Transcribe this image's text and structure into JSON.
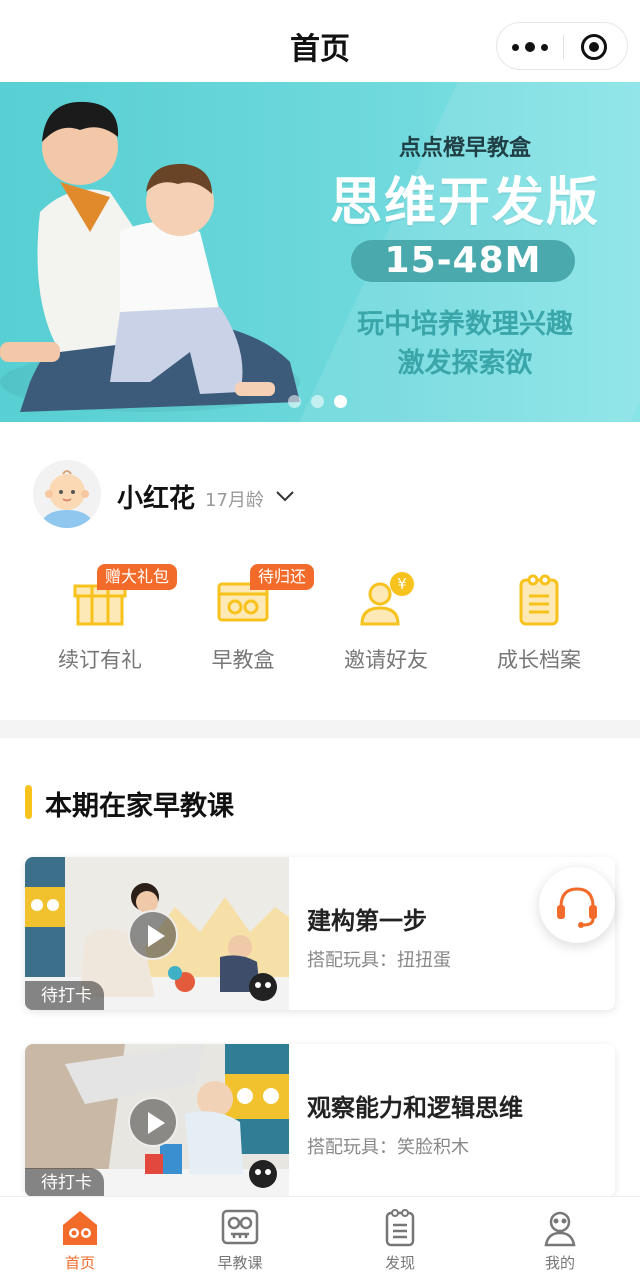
{
  "titlebar": {
    "title": "首页"
  },
  "banner": {
    "brand": "点点橙早教盒",
    "headline": "思维开发版",
    "age_range": "15-48M",
    "line1": "玩中培养数理兴趣",
    "line2": "激发探索欲",
    "slides_total": 3,
    "active_slide": 3
  },
  "profile": {
    "name": "小红花",
    "age": "17月龄"
  },
  "quick_actions": [
    {
      "label": "续订有礼",
      "tag": "赠大礼包",
      "icon": "gift-box-icon"
    },
    {
      "label": "早教盒",
      "tag": "待归还",
      "icon": "box-icon"
    },
    {
      "label": "邀请好友",
      "tag": "",
      "icon": "invite-friend-icon"
    },
    {
      "label": "成长档案",
      "tag": "",
      "icon": "growth-record-icon"
    }
  ],
  "section": {
    "title": "本期在家早教课"
  },
  "courses": [
    {
      "title": "建构第一步",
      "subtitle": "搭配玩具：扭扭蛋",
      "status": "待打卡"
    },
    {
      "title": "观察能力和逻辑思维",
      "subtitle": "搭配玩具：笑脸积木",
      "status": "待打卡"
    }
  ],
  "tabbar": [
    {
      "label": "首页",
      "icon": "home-icon",
      "active": true
    },
    {
      "label": "早教课",
      "icon": "course-icon",
      "active": false
    },
    {
      "label": "发现",
      "icon": "discover-icon",
      "active": false
    },
    {
      "label": "我的",
      "icon": "profile-icon",
      "active": false
    }
  ],
  "colors": {
    "accent": "#f26b2a",
    "yellow": "#f7c21c",
    "banner": "#6fd9dd"
  }
}
